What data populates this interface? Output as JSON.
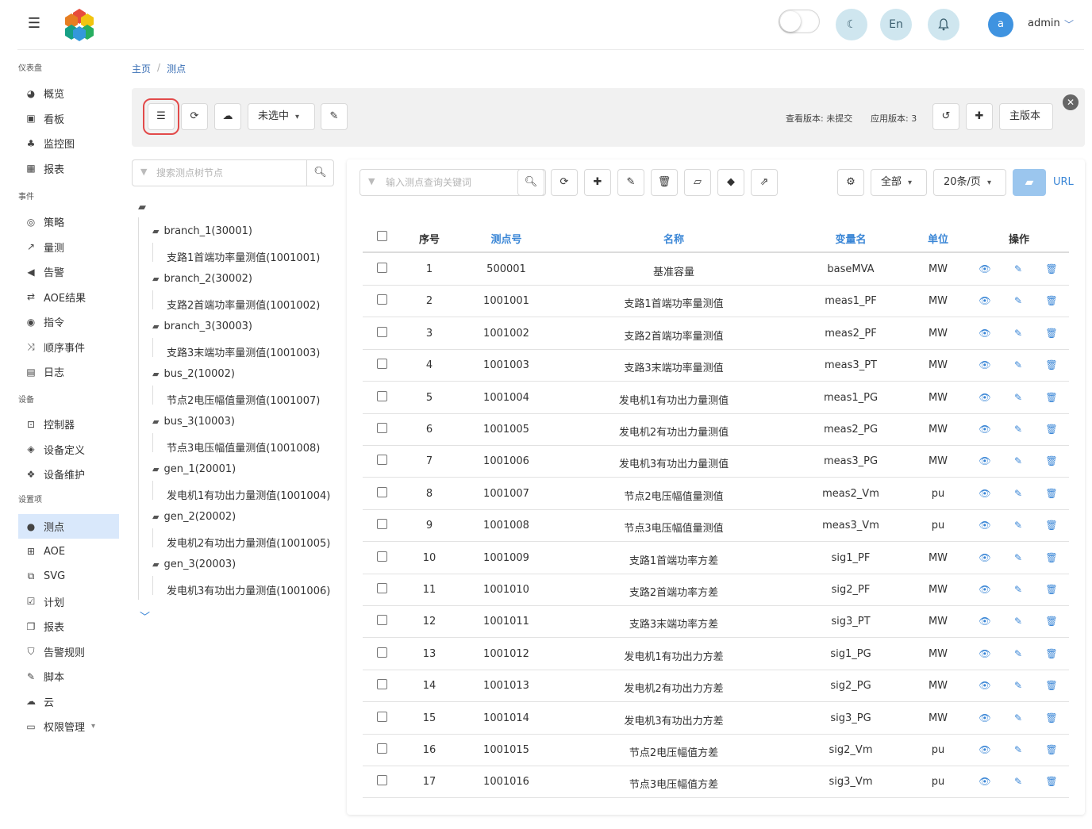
{
  "header": {
    "lang_label": "En",
    "avatar_letter": "a",
    "username": "admin"
  },
  "sidebar": {
    "sections": [
      {
        "title": "仪表盘",
        "items": [
          {
            "label": "概览",
            "icon": "dashboard-icon",
            "glyph": "◕"
          },
          {
            "label": "看板",
            "icon": "board-icon",
            "glyph": "▣"
          },
          {
            "label": "监控图",
            "icon": "sitemap-icon",
            "glyph": "♣"
          },
          {
            "label": "报表",
            "icon": "table-icon",
            "glyph": "▦"
          }
        ]
      },
      {
        "title": "事件",
        "items": [
          {
            "label": "策略",
            "icon": "target-icon",
            "glyph": "◎"
          },
          {
            "label": "量测",
            "icon": "chart-line-icon",
            "glyph": "↗"
          },
          {
            "label": "告警",
            "icon": "bullhorn-icon",
            "glyph": "◀"
          },
          {
            "label": "AOE结果",
            "icon": "exchange-icon",
            "glyph": "⇄"
          },
          {
            "label": "指令",
            "icon": "podcast-icon",
            "glyph": "◉"
          },
          {
            "label": "顺序事件",
            "icon": "shuffle-icon",
            "glyph": "⤨"
          },
          {
            "label": "日志",
            "icon": "book-icon",
            "glyph": "▤"
          }
        ]
      },
      {
        "title": "设备",
        "items": [
          {
            "label": "控制器",
            "icon": "controller-icon",
            "glyph": "⊡"
          },
          {
            "label": "设备定义",
            "icon": "cube-icon",
            "glyph": "◈"
          },
          {
            "label": "设备维护",
            "icon": "cubes-icon",
            "glyph": "❖"
          }
        ]
      },
      {
        "title": "设置项",
        "items": [
          {
            "label": "测点",
            "icon": "map-pin-icon",
            "glyph": "●",
            "active": true
          },
          {
            "label": "AOE",
            "icon": "flow-icon",
            "glyph": "⊞"
          },
          {
            "label": "SVG",
            "icon": "clone-icon",
            "glyph": "⧉"
          },
          {
            "label": "计划",
            "icon": "calendar-check-icon",
            "glyph": "☑"
          },
          {
            "label": "报表",
            "icon": "copy-icon",
            "glyph": "❐"
          },
          {
            "label": "告警规则",
            "icon": "shield-icon",
            "glyph": "⛉"
          },
          {
            "label": "脚本",
            "icon": "plug-icon",
            "glyph": "✎"
          },
          {
            "label": "云",
            "icon": "cloud-icon",
            "glyph": "☁"
          },
          {
            "label": "权限管理",
            "icon": "id-card-icon",
            "glyph": "▭",
            "chevron": true
          }
        ]
      }
    ]
  },
  "breadcrumb": {
    "home": "主页",
    "current": "测点"
  },
  "toolbar": {
    "select_label": "未选中",
    "view_version": "查看版本: 未提交",
    "app_version": "应用版本: 3",
    "main_version_label": "主版本"
  },
  "tree": {
    "search_placeholder": "搜索测点树节点",
    "nodes": [
      {
        "label": "branch_1(30001)",
        "leaf": "支路1首端功率量测值(1001001)"
      },
      {
        "label": "branch_2(30002)",
        "leaf": "支路2首端功率量测值(1001002)"
      },
      {
        "label": "branch_3(30003)",
        "leaf": "支路3末端功率量测值(1001003)"
      },
      {
        "label": "bus_2(10002)",
        "leaf": "节点2电压幅值量测值(1001007)"
      },
      {
        "label": "bus_3(10003)",
        "leaf": "节点3电压幅值量测值(1001008)"
      },
      {
        "label": "gen_1(20001)",
        "leaf": "发电机1有功出力量测值(1001004)"
      },
      {
        "label": "gen_2(20002)",
        "leaf": "发电机2有功出力量测值(1001005)"
      },
      {
        "label": "gen_3(20003)",
        "leaf": "发电机3有功出力量测值(1001006)"
      }
    ]
  },
  "table": {
    "search_placeholder": "输入测点查询关键词",
    "filter_label": "全部",
    "page_size_label": "20条/页",
    "url_label": "URL",
    "headers": {
      "index": "序号",
      "id": "测点号",
      "name": "名称",
      "var": "变量名",
      "unit": "单位",
      "ops": "操作"
    },
    "rows": [
      {
        "idx": "1",
        "id": "500001",
        "name": "基准容量",
        "var": "baseMVA",
        "unit": "MW"
      },
      {
        "idx": "2",
        "id": "1001001",
        "name": "支路1首端功率量测值",
        "var": "meas1_PF",
        "unit": "MW"
      },
      {
        "idx": "3",
        "id": "1001002",
        "name": "支路2首端功率量测值",
        "var": "meas2_PF",
        "unit": "MW"
      },
      {
        "idx": "4",
        "id": "1001003",
        "name": "支路3末端功率量测值",
        "var": "meas3_PT",
        "unit": "MW"
      },
      {
        "idx": "5",
        "id": "1001004",
        "name": "发电机1有功出力量测值",
        "var": "meas1_PG",
        "unit": "MW"
      },
      {
        "idx": "6",
        "id": "1001005",
        "name": "发电机2有功出力量测值",
        "var": "meas2_PG",
        "unit": "MW"
      },
      {
        "idx": "7",
        "id": "1001006",
        "name": "发电机3有功出力量测值",
        "var": "meas3_PG",
        "unit": "MW"
      },
      {
        "idx": "8",
        "id": "1001007",
        "name": "节点2电压幅值量测值",
        "var": "meas2_Vm",
        "unit": "pu"
      },
      {
        "idx": "9",
        "id": "1001008",
        "name": "节点3电压幅值量测值",
        "var": "meas3_Vm",
        "unit": "pu"
      },
      {
        "idx": "10",
        "id": "1001009",
        "name": "支路1首端功率方差",
        "var": "sig1_PF",
        "unit": "MW"
      },
      {
        "idx": "11",
        "id": "1001010",
        "name": "支路2首端功率方差",
        "var": "sig2_PF",
        "unit": "MW"
      },
      {
        "idx": "12",
        "id": "1001011",
        "name": "支路3末端功率方差",
        "var": "sig3_PT",
        "unit": "MW"
      },
      {
        "idx": "13",
        "id": "1001012",
        "name": "发电机1有功出力方差",
        "var": "sig1_PG",
        "unit": "MW"
      },
      {
        "idx": "14",
        "id": "1001013",
        "name": "发电机2有功出力方差",
        "var": "sig2_PG",
        "unit": "MW"
      },
      {
        "idx": "15",
        "id": "1001014",
        "name": "发电机3有功出力方差",
        "var": "sig3_PG",
        "unit": "MW"
      },
      {
        "idx": "16",
        "id": "1001015",
        "name": "节点2电压幅值方差",
        "var": "sig2_Vm",
        "unit": "pu"
      },
      {
        "idx": "17",
        "id": "1001016",
        "name": "节点3电压幅值方差",
        "var": "sig3_Vm",
        "unit": "pu"
      }
    ]
  },
  "colors": {
    "accent": "#3a86d6",
    "active_bg": "#d9e8fb",
    "highlight": "#e24a4a"
  }
}
